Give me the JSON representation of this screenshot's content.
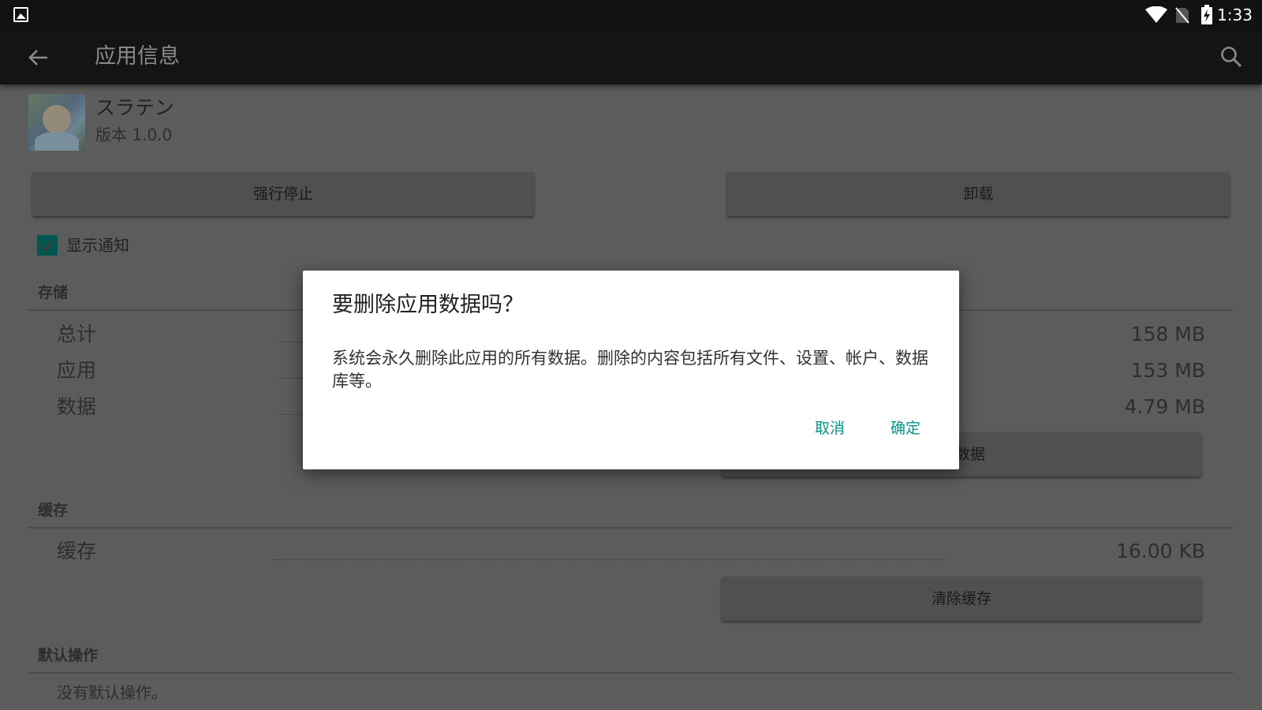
{
  "status_bar": {
    "time": "1:33",
    "icons": [
      "gallery-icon",
      "wifi-icon",
      "no-sim-icon",
      "battery-charging-icon"
    ]
  },
  "app_bar": {
    "title": "应用信息",
    "back_icon": "arrow-back-icon",
    "search_icon": "search-icon"
  },
  "app": {
    "name": "スラテン",
    "version": "版本 1.0.0"
  },
  "buttons": {
    "force_stop": "强行停止",
    "uninstall": "卸载",
    "clear_data_partial": "数据",
    "clear_cache": "清除缓存"
  },
  "notification": {
    "label": "显示通知",
    "checked": true
  },
  "storage": {
    "header": "存储",
    "rows": [
      {
        "label": "总计",
        "value": "158 MB"
      },
      {
        "label": "应用",
        "value": "153 MB"
      },
      {
        "label": "数据",
        "value": "4.79 MB"
      }
    ]
  },
  "cache": {
    "header": "缓存",
    "label": "缓存",
    "value": "16.00 KB"
  },
  "defaults": {
    "header": "默认操作",
    "text": "没有默认操作。"
  },
  "dialog": {
    "title": "要删除应用数据吗？",
    "message": "系统会永久删除此应用的所有数据。删除的内容包括所有文件、设置、帐户、数据库等。",
    "cancel": "取消",
    "confirm": "确定"
  },
  "colors": {
    "accent": "#009688",
    "scrim_bg": "#5c5c5c"
  }
}
